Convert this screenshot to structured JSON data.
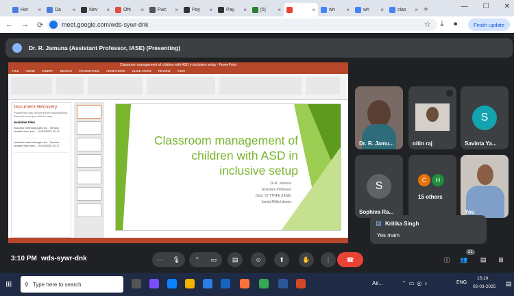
{
  "tabs": [
    {
      "label": "Hor",
      "color": "#4a7dde"
    },
    {
      "label": "Da",
      "color": "#4a7dde"
    },
    {
      "label": "Nev",
      "color": "#333"
    },
    {
      "label": "Offi",
      "color": "#e74c3c"
    },
    {
      "label": "Fwc",
      "color": "#555"
    },
    {
      "label": "Pay",
      "color": "#333"
    },
    {
      "label": "Pay",
      "color": "#333"
    },
    {
      "label": "[5]",
      "color": "#2e7d32"
    },
    {
      "label": "",
      "color": "#ea4335"
    },
    {
      "label": "wh",
      "color": "#4285f4"
    },
    {
      "label": "wh",
      "color": "#4285f4"
    },
    {
      "label": "clas",
      "color": "#4285f4"
    }
  ],
  "url": "meet.google.com/wds-sywr-dnk",
  "finish_update": "Finish update",
  "presenter": "Dr. R. Jamuna (Assistant Professor, IASE) (Presenting)",
  "ppt": {
    "window_title": "Classroom management of children with ASD in inclusive setup - PowerPoint",
    "ribbon_tabs": [
      "FILE",
      "HOME",
      "INSERT",
      "DESIGN",
      "TRANSITIONS",
      "ANIMATIONS",
      "SLIDE SHOW",
      "REVIEW",
      "VIEW"
    ],
    "recovery_title": "Document Recovery",
    "recovery_text": "PowerPoint has recovered the following files. Save the ones you wish to keep.",
    "available": "Available Files",
    "files": [
      "Inclusive methodologies for... Version created from the l... 01/03/2025 23:12",
      "Inclusive methodologies for... Version created from the l... 01/03/2025 22:17"
    ],
    "slide_title": "Classroom management of children with ASD in inclusive setup",
    "slide_meta": [
      "Dr.R. Jamuna",
      "Assistant Professor",
      "Dept. Of TTNFE (IASE)",
      "Jamia Millia Islamia"
    ]
  },
  "participants": [
    {
      "name": "Dr. R. Jamu...",
      "type": "video"
    },
    {
      "name": "nitin raj",
      "type": "video"
    },
    {
      "name": "Savinta Ya...",
      "letter": "S",
      "color": "#12a4af"
    },
    {
      "name": "Sophiva Ra...",
      "letter": "S",
      "color": "#5f6368"
    },
    {
      "name": "15 others",
      "letters": [
        "C",
        "H"
      ]
    },
    {
      "name": "You",
      "type": "video"
    }
  ],
  "chat": {
    "sender": "Kritika Singh",
    "message": "Yes mam"
  },
  "meeting": {
    "time": "3:10 PM",
    "code": "wds-sywr-dnk",
    "count": "21"
  },
  "taskbar": {
    "search": "Type here to search",
    "weather": "Air...",
    "lang": "ENG",
    "time": "15:10",
    "date": "02-03-2025"
  }
}
